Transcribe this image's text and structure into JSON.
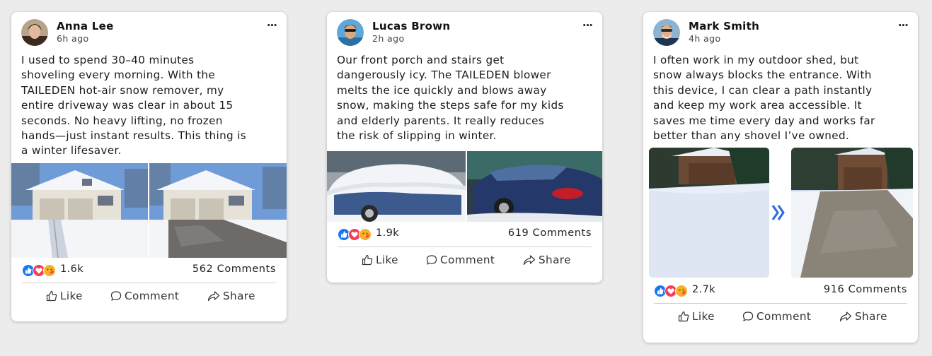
{
  "posts": [
    {
      "author": "Anna Lee",
      "time": "6h ago",
      "body": "I used to spend 30–40 minutes shoveling every morning. With the TAILEDEN hot-air snow remover, my entire driveway was clear in about 15 seconds. No heavy lifting, no frozen hands—just instant results. This thing is a winter lifesaver.",
      "body_lines": [
        "I used to spend 30–40 minutes",
        "shoveling every morning. With the",
        "TAILEDEN hot-air snow remover, my",
        "entire driveway was clear in about 15",
        "seconds. No heavy lifting, no frozen",
        "hands—just instant results. This thing is",
        "a winter lifesaver."
      ],
      "reactions": "1.6k",
      "comments": "562 Comments",
      "more": "···"
    },
    {
      "author": "Lucas Brown",
      "time": "2h ago",
      "body": "Our front porch and stairs get dangerously icy. The TAILEDEN blower melts the ice quickly and blows away snow, making the steps safe for my kids and elderly parents. It really reduces the risk of slipping in winter.",
      "body_lines": [
        "Our front porch and stairs get",
        "dangerously icy. The TAILEDEN blower",
        "melts the ice quickly and blows away",
        "snow, making the steps safe for my kids",
        "and elderly parents. It really reduces",
        "the risk of slipping in winter."
      ],
      "reactions": "1.9k",
      "comments": "619 Comments",
      "more": "···"
    },
    {
      "author": "Mark Smith",
      "time": "4h ago",
      "body": "I often work in my outdoor shed, but snow always blocks the entrance. With this device, I can clear a path instantly and keep my work area accessible. It saves me time every day and works far better than any shovel I’ve owned.",
      "body_lines": [
        "I often work in my outdoor shed, but",
        "snow always blocks the entrance. With",
        "this device, I can clear a path instantly",
        "and keep my work area accessible. It",
        "saves me time every day and works far",
        "better than any shovel I’ve owned."
      ],
      "reactions": "2.7k",
      "comments": "916 Comments",
      "more": "···"
    }
  ],
  "actions": {
    "like": "Like",
    "comment": "Comment",
    "share": "Share"
  },
  "icons": {
    "reactions": [
      "like-icon",
      "love-icon",
      "care-icon"
    ],
    "menu": "more-options-icon",
    "before_after": "double-chevron-right-icon"
  },
  "colors": {
    "like_blue": "#1877f2",
    "love_red": "#f33e58",
    "care_yellow": "#f7b125",
    "arrow_blue": "#2f6de0"
  }
}
